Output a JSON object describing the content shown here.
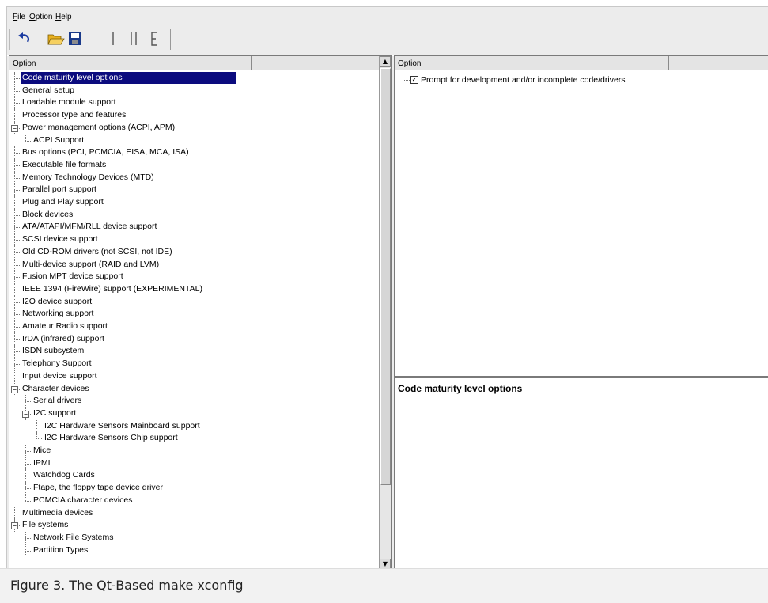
{
  "menubar": {
    "items": [
      {
        "label": "File",
        "accel": "F",
        "rest": "ile"
      },
      {
        "label": "Option",
        "accel": "O",
        "rest": "ption"
      },
      {
        "label": "Help",
        "accel": "H",
        "rest": "elp"
      }
    ]
  },
  "toolbar": {
    "buttons": [
      {
        "name": "back-button",
        "icon": "undo-arrow-icon"
      },
      {
        "name": "load-button",
        "icon": "open-folder-icon"
      },
      {
        "name": "save-button",
        "icon": "floppy-disk-icon"
      },
      {
        "name": "single-view-button",
        "icon": "single-view-icon",
        "glyph": "|"
      },
      {
        "name": "split-view-button",
        "icon": "split-view-icon",
        "glyph": "||"
      },
      {
        "name": "full-view-button",
        "icon": "full-view-icon",
        "glyph": "E"
      }
    ],
    "colors": {
      "folder": "#e8b020",
      "disk": "#1a3a8a",
      "arrow": "#1a3aa0"
    }
  },
  "left_pane": {
    "header": "Option",
    "selected_color": "#0b0b7e",
    "tree": [
      {
        "label": "Code maturity level options",
        "depth": 0,
        "selected": true
      },
      {
        "label": "General setup",
        "depth": 0
      },
      {
        "label": "Loadable module support",
        "depth": 0
      },
      {
        "label": "Processor type and features",
        "depth": 0
      },
      {
        "label": "Power management options (ACPI, APM)",
        "depth": 0,
        "expander": "minus"
      },
      {
        "label": "ACPI Support",
        "depth": 1,
        "last": true
      },
      {
        "label": "Bus options (PCI, PCMCIA, EISA, MCA, ISA)",
        "depth": 0
      },
      {
        "label": "Executable file formats",
        "depth": 0
      },
      {
        "label": "Memory Technology Devices (MTD)",
        "depth": 0
      },
      {
        "label": "Parallel port support",
        "depth": 0
      },
      {
        "label": "Plug and Play support",
        "depth": 0
      },
      {
        "label": "Block devices",
        "depth": 0
      },
      {
        "label": "ATA/ATAPI/MFM/RLL device support",
        "depth": 0
      },
      {
        "label": "SCSI device support",
        "depth": 0
      },
      {
        "label": "Old CD-ROM drivers (not SCSI, not IDE)",
        "depth": 0
      },
      {
        "label": "Multi-device support (RAID and LVM)",
        "depth": 0
      },
      {
        "label": "Fusion MPT device support",
        "depth": 0
      },
      {
        "label": "IEEE 1394 (FireWire) support (EXPERIMENTAL)",
        "depth": 0
      },
      {
        "label": "I2O device support",
        "depth": 0
      },
      {
        "label": "Networking support",
        "depth": 0
      },
      {
        "label": "Amateur Radio support",
        "depth": 0
      },
      {
        "label": "IrDA (infrared) support",
        "depth": 0
      },
      {
        "label": "ISDN subsystem",
        "depth": 0
      },
      {
        "label": "Telephony Support",
        "depth": 0
      },
      {
        "label": "Input device support",
        "depth": 0
      },
      {
        "label": "Character devices",
        "depth": 0,
        "expander": "minus"
      },
      {
        "label": "Serial drivers",
        "depth": 1
      },
      {
        "label": "I2C support",
        "depth": 1,
        "expander": "minus"
      },
      {
        "label": "I2C Hardware Sensors Mainboard support",
        "depth": 2
      },
      {
        "label": "I2C Hardware Sensors Chip support",
        "depth": 2,
        "last": true
      },
      {
        "label": "Mice",
        "depth": 1
      },
      {
        "label": "IPMI",
        "depth": 1
      },
      {
        "label": "Watchdog Cards",
        "depth": 1
      },
      {
        "label": "Ftape, the floppy tape device driver",
        "depth": 1
      },
      {
        "label": "PCMCIA character devices",
        "depth": 1,
        "last": true
      },
      {
        "label": "Multimedia devices",
        "depth": 0
      },
      {
        "label": "File systems",
        "depth": 0,
        "expander": "minus"
      },
      {
        "label": "Network File Systems",
        "depth": 1
      },
      {
        "label": "Partition Types",
        "depth": 1
      }
    ]
  },
  "right_top": {
    "header": "Option",
    "items": [
      {
        "label": "Prompt for development and/or incomplete code/drivers",
        "checked": true
      }
    ]
  },
  "right_bottom": {
    "title": "Code maturity level options"
  },
  "caption": "Figure 3. The Qt-Based make xconfig"
}
